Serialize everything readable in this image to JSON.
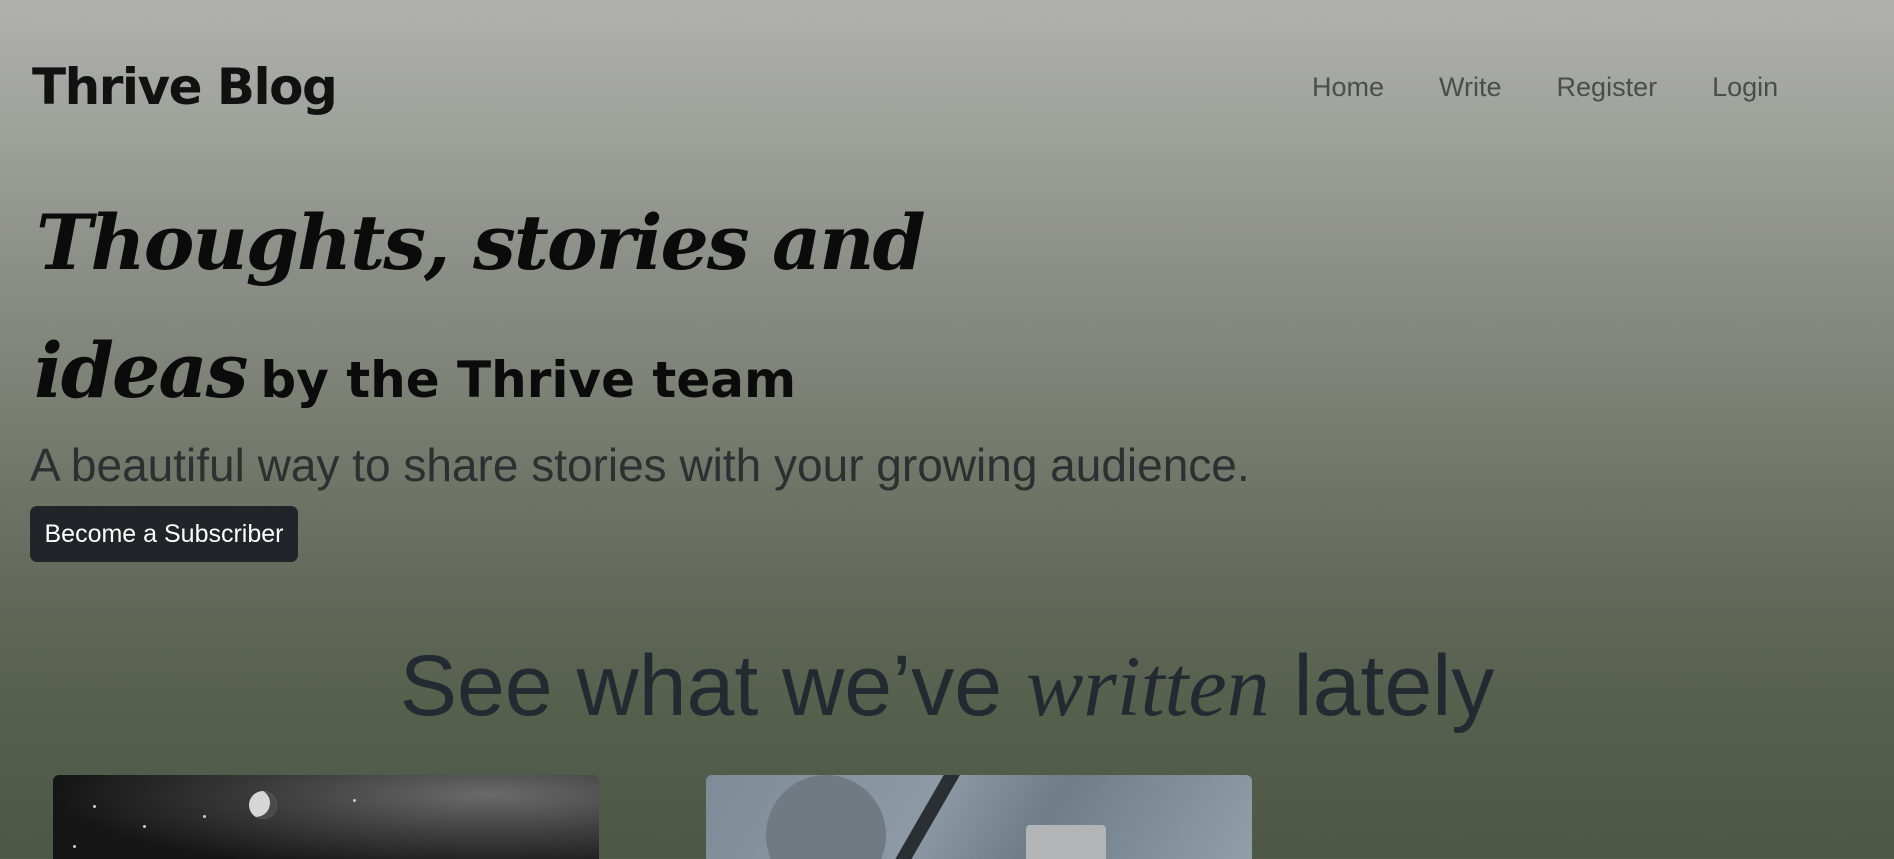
{
  "header": {
    "brand": "Thrive Blog",
    "nav": [
      "Home",
      "Write",
      "Register",
      "Login"
    ]
  },
  "hero": {
    "line1": "Thoughts, stories and",
    "line2_script": "ideas",
    "line2_plain": "by the Thrive team",
    "subtitle": "A beautiful way to share stories with your growing audience.",
    "cta_label": "Become a Subscriber"
  },
  "section": {
    "title_before": "See what we’ve",
    "title_emphasis": "written",
    "title_after": "lately"
  },
  "cards": [
    {
      "image": "night-sky-moon"
    },
    {
      "image": "rainy-car-window"
    }
  ]
}
